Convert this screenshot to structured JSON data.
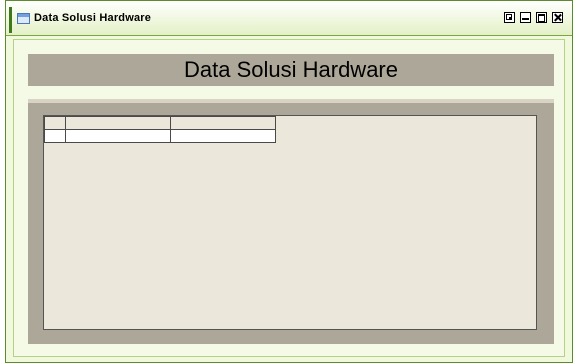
{
  "window": {
    "title": "Data Solusi Hardware",
    "controls": {
      "restore": "restore",
      "minimize": "minimize",
      "maximize": "maximize",
      "close": "close"
    }
  },
  "main": {
    "heading": "Data Solusi Hardware"
  },
  "grid": {
    "columns": [
      "",
      ""
    ],
    "rows": [
      [
        "",
        ""
      ]
    ]
  },
  "colors": {
    "titlebar": "#eef7db",
    "window_border": "#5c8a2e",
    "panel_gray": "#aca798",
    "grid_background": "#ebe8db"
  }
}
